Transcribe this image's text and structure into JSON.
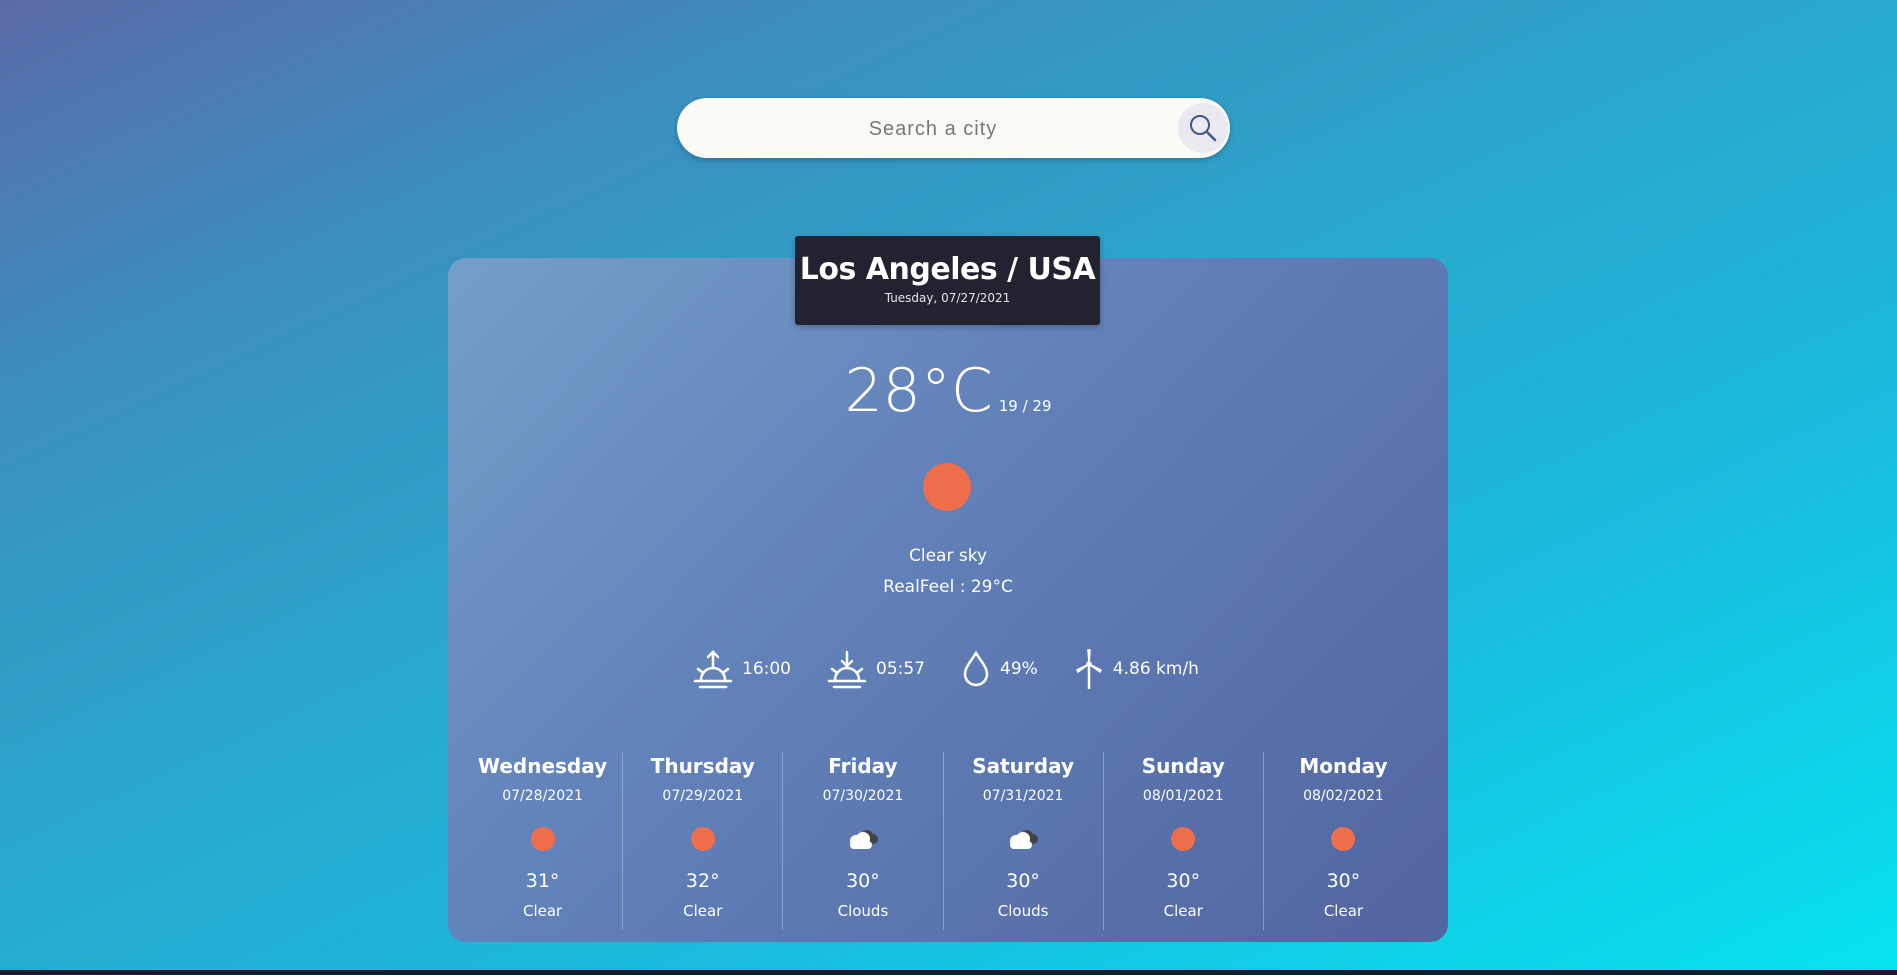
{
  "search": {
    "placeholder": "Search a city"
  },
  "current": {
    "location": "Los Angeles / USA",
    "date": "Tuesday, 07/27/2021",
    "temperature": "28°C",
    "min_max": "19 / 29",
    "description": "Clear sky",
    "realfeel": "RealFeel : 29°C",
    "icon": "sun-icon",
    "sunrise": "16:00",
    "sunset": "05:57",
    "humidity": "49%",
    "wind": "4.86 km/h"
  },
  "forecast": [
    {
      "day": "Wednesday",
      "date": "07/28/2021",
      "icon": "sun-icon",
      "temp": "31°",
      "desc": "Clear"
    },
    {
      "day": "Thursday",
      "date": "07/29/2021",
      "icon": "sun-icon",
      "temp": "32°",
      "desc": "Clear"
    },
    {
      "day": "Friday",
      "date": "07/30/2021",
      "icon": "cloud-icon",
      "temp": "30°",
      "desc": "Clouds"
    },
    {
      "day": "Saturday",
      "date": "07/31/2021",
      "icon": "cloud-icon",
      "temp": "30°",
      "desc": "Clouds"
    },
    {
      "day": "Sunday",
      "date": "08/01/2021",
      "icon": "sun-icon",
      "temp": "30°",
      "desc": "Clear"
    },
    {
      "day": "Monday",
      "date": "08/02/2021",
      "icon": "sun-icon",
      "temp": "30°",
      "desc": "Clear"
    }
  ],
  "colors": {
    "sun": "#ee6e4c",
    "city_box": "#222230",
    "search_bg": "#fbfbf5"
  }
}
